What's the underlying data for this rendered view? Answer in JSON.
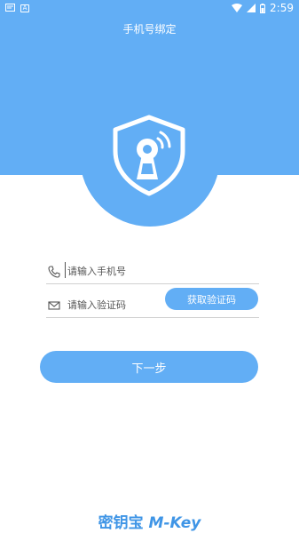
{
  "status_bar": {
    "time": "2:59",
    "left_icons": [
      "notification-icon",
      "a-badge-icon"
    ],
    "right_icons": [
      "wifi-icon",
      "signal-icon",
      "battery-icon"
    ]
  },
  "header": {
    "title": "手机号绑定",
    "background_color": "#62aef5"
  },
  "logo": {
    "icon": "shield-keyhole-icon"
  },
  "form": {
    "phone": {
      "icon": "phone-icon",
      "placeholder": "请输入手机号",
      "value": ""
    },
    "code": {
      "icon": "mail-icon",
      "placeholder": "请输入验证码",
      "value": ""
    },
    "get_code_label": "获取验证码"
  },
  "next_label": "下一步",
  "brand": {
    "cn": "密钥宝",
    "en": "M-Key",
    "color": "#3f95e6"
  }
}
